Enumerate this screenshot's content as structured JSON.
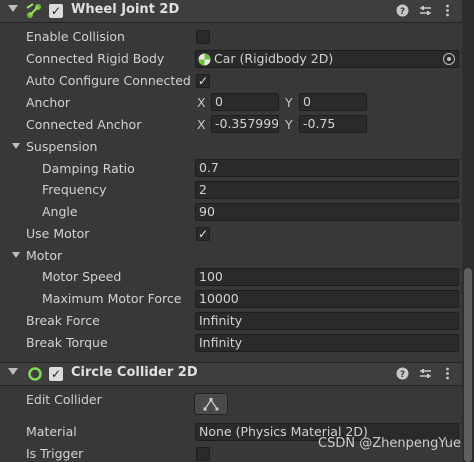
{
  "wheel_joint": {
    "title": "Wheel Joint 2D",
    "enabled": true,
    "rows": {
      "enable_collision": "Enable Collision",
      "connected_rigid_body": "Connected Rigid Body",
      "connected_rigid_body_value": "Car (Rigidbody 2D)",
      "auto_configure": "Auto Configure Connected",
      "anchor": "Anchor",
      "anchor_x": "0",
      "anchor_y": "0",
      "connected_anchor": "Connected Anchor",
      "connected_anchor_x": "-0.357999",
      "connected_anchor_y": "-0.75",
      "axis_x": "X",
      "axis_y": "Y"
    },
    "suspension": {
      "label": "Suspension",
      "damping_ratio": "Damping Ratio",
      "damping_ratio_value": "0.7",
      "frequency": "Frequency",
      "frequency_value": "2",
      "angle": "Angle",
      "angle_value": "90"
    },
    "use_motor": "Use Motor",
    "motor": {
      "label": "Motor",
      "motor_speed": "Motor Speed",
      "motor_speed_value": "100",
      "max_motor_force": "Maximum Motor Force",
      "max_motor_force_value": "10000"
    },
    "break_force": "Break Force",
    "break_force_value": "Infinity",
    "break_torque": "Break Torque",
    "break_torque_value": "Infinity"
  },
  "circle_collider": {
    "title": "Circle Collider 2D",
    "edit_collider": "Edit Collider",
    "material": "Material",
    "material_value": "None (Physics Material 2D)",
    "is_trigger": "Is Trigger"
  },
  "watermark": "CSDN @ZhenpengYue",
  "icons": {
    "help": "help-icon",
    "presets": "presets-icon",
    "more": "more-icon",
    "check": "✓"
  }
}
